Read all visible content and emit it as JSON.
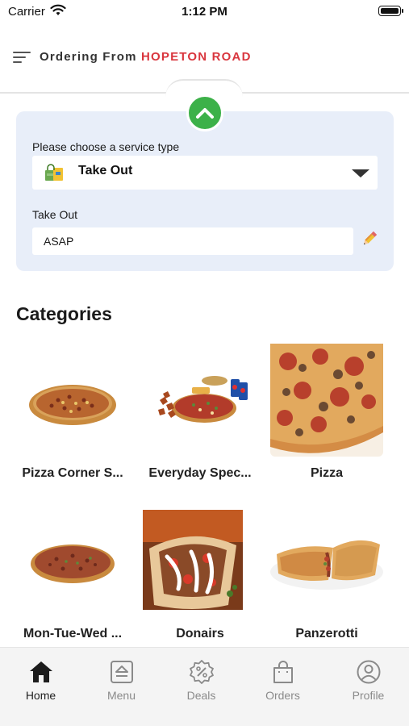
{
  "status_bar": {
    "carrier": "Carrier",
    "time": "1:12 PM"
  },
  "header": {
    "prefix": "Ordering From",
    "location": "HOPETON ROAD",
    "location_color": "#d9363e"
  },
  "service": {
    "prompt": "Please choose a service type",
    "selected": "Take Out",
    "time_label": "Take Out",
    "time_value": "ASAP",
    "panel_color": "#e8eef9",
    "toggle_color": "#3cb149"
  },
  "categories": {
    "title": "Categories",
    "items": [
      {
        "label": "Pizza Corner S...",
        "image": "pizza-icon"
      },
      {
        "label": "Everyday Spec...",
        "image": "combo-meal-icon"
      },
      {
        "label": "Pizza",
        "image": "pizza-closeup-icon"
      },
      {
        "label": "Mon-Tue-Wed ...",
        "image": "pizza-icon"
      },
      {
        "label": "Donairs",
        "image": "donair-icon"
      },
      {
        "label": "Panzerotti",
        "image": "panzerotti-icon"
      }
    ]
  },
  "tab_bar": {
    "tabs": [
      {
        "label": "Home",
        "icon": "home-icon",
        "active": true
      },
      {
        "label": "Menu",
        "icon": "menu-icon",
        "active": false
      },
      {
        "label": "Deals",
        "icon": "deals-icon",
        "active": false
      },
      {
        "label": "Orders",
        "icon": "orders-icon",
        "active": false
      },
      {
        "label": "Profile",
        "icon": "profile-icon",
        "active": false
      }
    ]
  }
}
